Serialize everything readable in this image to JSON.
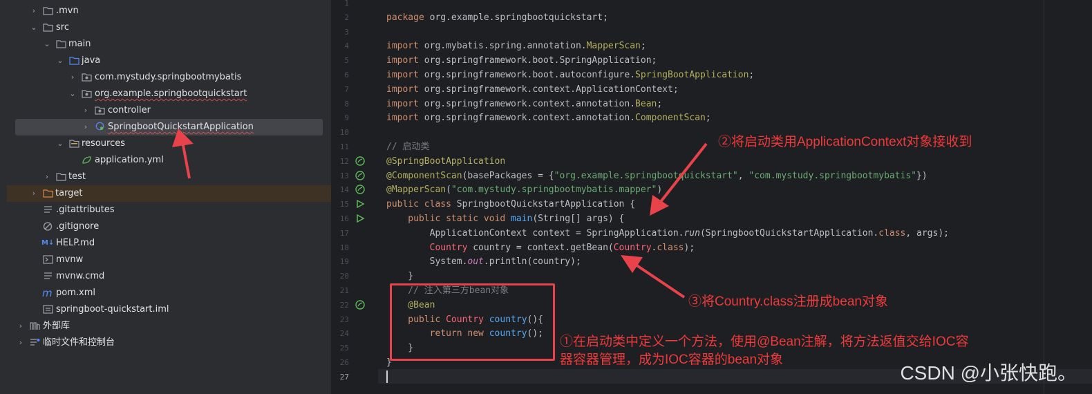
{
  "tree": {
    "rows": [
      {
        "label": ".mvn",
        "indent": 1,
        "chev": "›",
        "icon": "folder-icon"
      },
      {
        "label": "src",
        "indent": 1,
        "chev": "⌄",
        "icon": "folder-icon"
      },
      {
        "label": "main",
        "indent": 2,
        "chev": "⌄",
        "icon": "folder-icon"
      },
      {
        "label": "java",
        "indent": 3,
        "chev": "⌄",
        "icon": "source-folder-icon"
      },
      {
        "label": "com.mystudy.springbootmybatis",
        "indent": 4,
        "chev": "›",
        "icon": "package-icon"
      },
      {
        "label": "org.example.springbootquickstart",
        "indent": 4,
        "chev": "⌄",
        "icon": "package-icon"
      },
      {
        "label": "controller",
        "indent": 5,
        "chev": "›",
        "icon": "package-icon"
      },
      {
        "label": "SpringbootQuickstartApplication",
        "indent": 5,
        "chev": "›",
        "icon": "spring-class-icon"
      },
      {
        "label": "resources",
        "indent": 3,
        "chev": "⌄",
        "icon": "resources-folder-icon"
      },
      {
        "label": "application.yml",
        "indent": 4,
        "chev": "",
        "icon": "yml-file-icon"
      },
      {
        "label": "test",
        "indent": 2,
        "chev": "›",
        "icon": "folder-icon"
      },
      {
        "label": "target",
        "indent": 1,
        "chev": "›",
        "icon": "excluded-folder-icon"
      },
      {
        "label": ".gitattributes",
        "indent": 2,
        "chev": "",
        "icon": "text-file-icon"
      },
      {
        "label": ".gitignore",
        "indent": 2,
        "chev": "",
        "icon": "ignore-file-icon"
      },
      {
        "label": "HELP.md",
        "indent": 2,
        "chev": "",
        "icon": "markdown-file-icon"
      },
      {
        "label": "mvnw",
        "indent": 2,
        "chev": "",
        "icon": "shell-file-icon"
      },
      {
        "label": "mvnw.cmd",
        "indent": 2,
        "chev": "",
        "icon": "text-file-icon"
      },
      {
        "label": "pom.xml",
        "indent": 2,
        "chev": "",
        "icon": "maven-file-icon"
      },
      {
        "label": "springboot-quickstart.iml",
        "indent": 2,
        "chev": "",
        "icon": "text-file-icon"
      },
      {
        "label": "外部库",
        "indent": 0,
        "chev": "›",
        "icon": "library-icon"
      },
      {
        "label": "临时文件和控制台",
        "indent": 0,
        "chev": "›",
        "icon": "scratches-icon"
      }
    ]
  },
  "editor": {
    "line_numbers": [
      "1",
      "2",
      "3",
      "4",
      "5",
      "6",
      "7",
      "8",
      "9",
      "10",
      "11",
      "12",
      "13",
      "14",
      "15",
      "16",
      "17",
      "18",
      "19",
      "20",
      "21",
      "22",
      "23",
      "24",
      "25",
      "26",
      "27"
    ],
    "lines": {
      "l2": {
        "k": "package",
        "t": " org.example.springbootquickstart;"
      },
      "l4": {
        "k": "import",
        "t": " org.mybatis.spring.annotation.",
        "a": "MapperScan",
        "e": ";"
      },
      "l5": {
        "k": "import",
        "t": " org.springframework.boot.SpringApplication;"
      },
      "l6": {
        "k": "import",
        "t": " org.springframework.boot.autoconfigure.",
        "a": "SpringBootApplication",
        "e": ";"
      },
      "l7": {
        "k": "import",
        "t": " org.springframework.context.ApplicationContext;"
      },
      "l8": {
        "k": "import",
        "t": " org.springframework.context.annotation.",
        "a": "Bean",
        "e": ";"
      },
      "l9": {
        "k": "import",
        "t": " org.springframework.context.annotation.",
        "a": "ComponentScan",
        "e": ";"
      },
      "l11": {
        "c": "// 启动类"
      },
      "l12": {
        "a": "@SpringBootApplication"
      },
      "l13": {
        "a": "@ComponentScan",
        "p1": "(basePackages = {",
        "s1": "\"org.example.springbootquickstart\"",
        "p2": ", ",
        "s2": "\"com.mystudy.springbootmybatis\"",
        "p3": "})"
      },
      "l14": {
        "a": "@MapperScan",
        "p1": "(",
        "s1": "\"com.mystudy.springbootmybatis.mapper\"",
        "p2": ")"
      },
      "l15": {
        "k": "public class",
        "t": " SpringbootQuickstartApplication {"
      },
      "l16": {
        "k": "    public static void",
        "f": " main",
        "t": "(String[] args) {"
      },
      "l17": {
        "t1": "        ApplicationContext context = SpringApplication.",
        "i": "run",
        "t2": "(SpringbootQuickstartApplication.",
        "k": "class",
        "t3": ", args);"
      },
      "l18": {
        "cr1": "        Country",
        "t1": " country = context.getBean(",
        "cr2": "Country",
        "t2": ".",
        "k": "class",
        "t3": ");"
      },
      "l19": {
        "t1": "        System.",
        "i": "out",
        "t2": ".println(country);"
      },
      "l20": {
        "t": "    }"
      },
      "l21": {
        "c": "    // 注入第三方bean对象"
      },
      "l22": {
        "a": "    @Bean"
      },
      "l23": {
        "k": "    public",
        "cr": " Country",
        "f": " country",
        "t": "(){"
      },
      "l24": {
        "k1": "        return",
        "k2": " new",
        "f": " country",
        "t": "();"
      },
      "l25": {
        "t": "    }"
      },
      "l26": {
        "t": "}"
      }
    }
  },
  "annotations": {
    "note1_line1": "①在启动类中定义一个方法，使用@Bean注解，将方法返值交给IOC容",
    "note1_line2": "器容器管理，成为IOC容器的bean对象",
    "note2": "②将启动类用ApplicationContext对象接收到",
    "note3": "③将Country.class注册成bean对象"
  },
  "watermark": "CSDN @小张快跑。",
  "colors": {
    "accent_red": "#e8434a",
    "keyword": "#cf8e6d",
    "string": "#6aab73",
    "annotation": "#b3ae60",
    "comment": "#7a7e85",
    "function": "#56a8f5"
  }
}
